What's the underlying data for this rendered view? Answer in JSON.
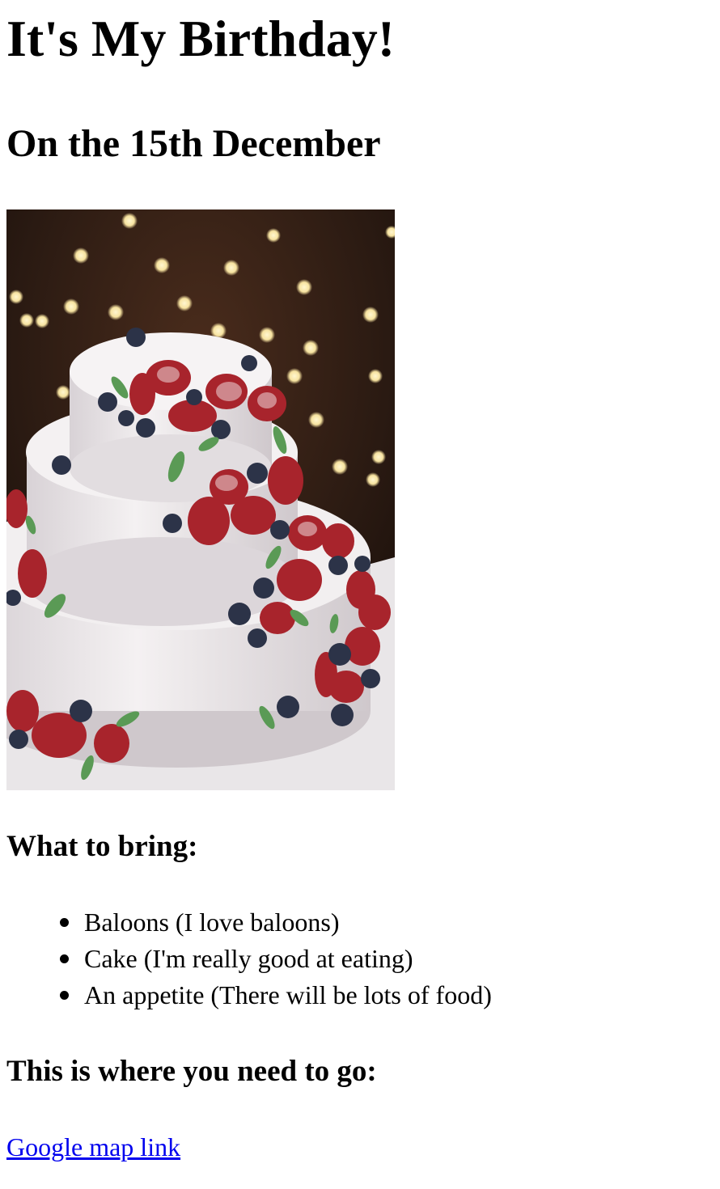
{
  "title": "It's My Birthday!",
  "subtitle": "On the 15th December",
  "image": {
    "description_icon": "cake-photo",
    "colors": {
      "background": "#2a1a12",
      "frosting": "#eeeaec",
      "strawberry": "#a8242c",
      "blueberry": "#2c3348",
      "bokeh": "#f7e3a0"
    }
  },
  "bring": {
    "heading": "What to bring:",
    "items": [
      "Baloons (I love baloons)",
      "Cake (I'm really good at eating)",
      "An appetite (There will be lots of food)"
    ]
  },
  "location": {
    "heading": "This is where you need to go:",
    "link_text": "Google map link",
    "link_color": "#0000ee"
  }
}
